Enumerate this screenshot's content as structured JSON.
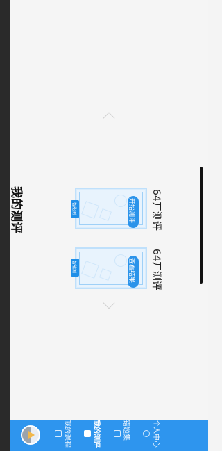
{
  "page": {
    "title": "我的测评"
  },
  "evaluations": [
    {
      "name": "64开测评",
      "tag": "智能测",
      "action": "开始测评"
    },
    {
      "name": "64开测评",
      "tag": "智能测",
      "action": "查看结果"
    }
  ],
  "tabbar": {
    "items": [
      {
        "label": "我的课程",
        "icon": "course-icon"
      },
      {
        "label": "我的测评",
        "icon": "evaluation-icon",
        "active": true
      },
      {
        "label": "错题集",
        "icon": "mistakes-icon"
      },
      {
        "label": "个人中心",
        "icon": "profile-icon"
      }
    ]
  },
  "colors": {
    "accent": "#2e95ee",
    "card_bg": "#e8f3fd",
    "page_bg": "#f5f5f5"
  }
}
